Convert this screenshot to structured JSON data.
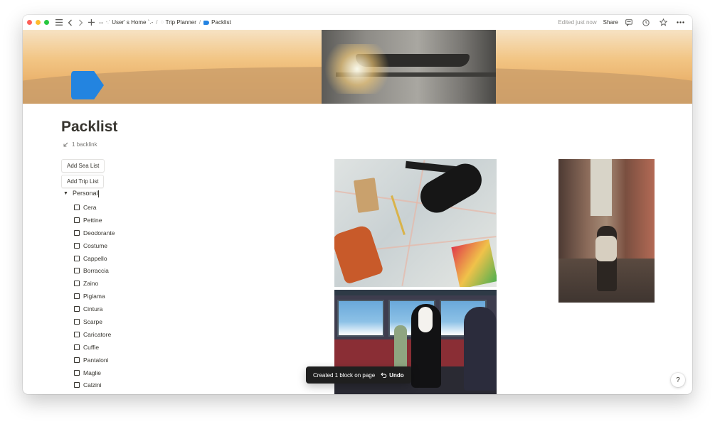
{
  "topbar": {
    "breadcrumbs": [
      {
        "emoji": "-.'",
        "label": "User' s Home `.-"
      },
      {
        "emoji": "",
        "label": "Trip Planner"
      },
      {
        "emoji": "",
        "label": "Packlist"
      }
    ],
    "separator": "/",
    "edited": "Edited just now",
    "share": "Share"
  },
  "page": {
    "title": "Packlist",
    "backlink": "1 backlink",
    "buttons": {
      "sea": "Add Sea List",
      "trip": "Add Trip List"
    },
    "toggle_label": "Personal",
    "items": [
      "Cera",
      "Pettine",
      "Deodorante",
      "Costume",
      "Cappello",
      "Borraccia",
      "Zaino",
      "Pigiama",
      "Cintura",
      "Scarpe",
      "Caricatore",
      "Cuffie",
      "Pantaloni",
      "Maglie",
      "Calzini"
    ]
  },
  "toast": {
    "message": "Created 1 block on page",
    "undo": "Undo"
  },
  "help": "?",
  "colors": {
    "page_icon": "#2384e0",
    "text": "#37352f",
    "muted": "#9b9a97",
    "toast_bg": "#1f1f1f"
  },
  "icons": {
    "topbar": [
      "sidebar-menu-icon",
      "back-icon",
      "forward-icon",
      "add-icon",
      "comments-icon",
      "history-icon",
      "favorite-star-icon",
      "more-options-icon"
    ],
    "page": "tag-icon"
  }
}
